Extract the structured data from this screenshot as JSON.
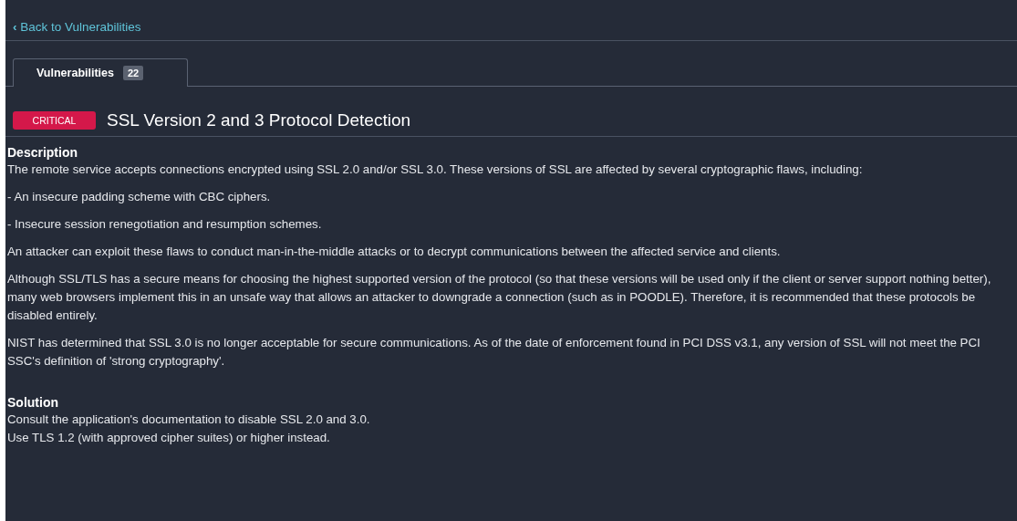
{
  "back_link": {
    "icon": "‹",
    "label": "Back to Vulnerabilities"
  },
  "tabs": [
    {
      "label": "Vulnerabilities",
      "count": "22",
      "selected": true
    }
  ],
  "vulnerability": {
    "severity": "CRITICAL",
    "title": "SSL Version 2 and 3 Protocol Detection"
  },
  "sections": [
    {
      "heading": "Description",
      "paragraphs": [
        "The remote service accepts connections encrypted using SSL 2.0 and/or SSL 3.0. These versions of SSL are affected by several cryptographic flaws, including:",
        "- An insecure padding scheme with CBC ciphers.",
        "- Insecure session renegotiation and resumption schemes.",
        "An attacker can exploit these flaws to conduct man-in-the-middle attacks or to decrypt communications between the affected service and clients.",
        "Although SSL/TLS has a secure means for choosing the highest supported version of the protocol (so that these versions will be used only if the client or server support nothing better), many web browsers implement this in an unsafe way that allows an attacker to downgrade a connection (such as in POODLE). Therefore, it is recommended that these protocols be disabled entirely.",
        "NIST has determined that SSL 3.0 is no longer acceptable for secure communications. As of the date of enforcement found in PCI DSS v3.1, any version of SSL will not meet the PCI SSC's definition of 'strong cryptography'."
      ]
    },
    {
      "heading": "Solution",
      "lines": [
        "Consult the application's documentation to disable SSL 2.0 and 3.0.",
        "Use TLS 1.2 (with approved cipher suites) or higher instead."
      ]
    }
  ]
}
